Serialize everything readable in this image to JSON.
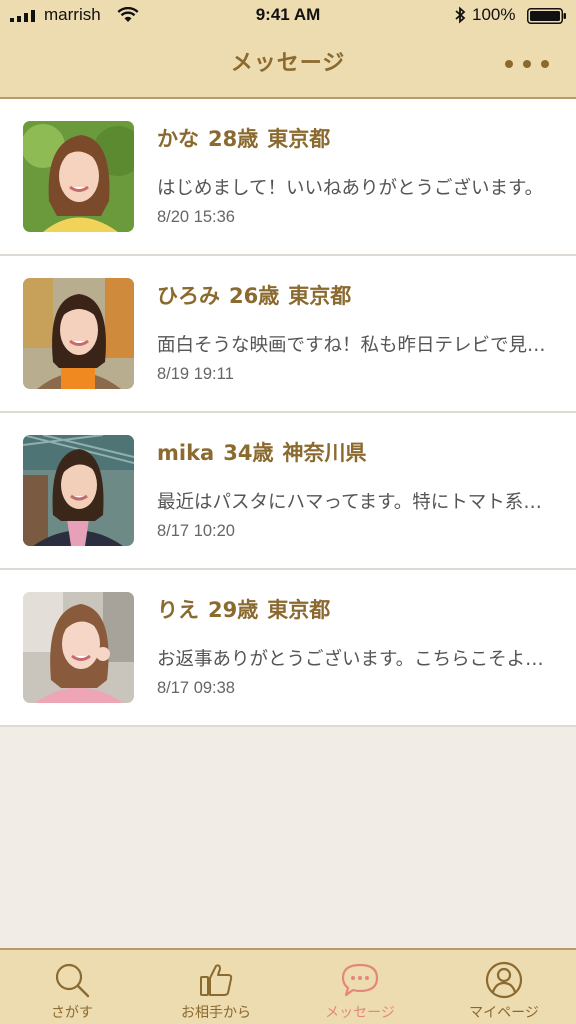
{
  "status_bar": {
    "carrier": "marrish",
    "time": "9:41 AM",
    "battery": "100%"
  },
  "header": {
    "title": "メッセージ",
    "more_icon": "more-dots-icon"
  },
  "messages": [
    {
      "name": "かな",
      "age": "28歳",
      "location": "東京都",
      "preview": "はじめまして！いいねありがとうございます。",
      "time": "8/20 15:36"
    },
    {
      "name": "ひろみ",
      "age": "26歳",
      "location": "東京都",
      "preview": "面白そうな映画ですね！私も昨日テレビで見ました。",
      "time": "8/19 19:11"
    },
    {
      "name": "mika",
      "age": "34歳",
      "location": "神奈川県",
      "preview": "最近はパスタにハマってます。特にトマト系が好きです。",
      "time": "8/17 10:20"
    },
    {
      "name": "りえ",
      "age": "29歳",
      "location": "東京都",
      "preview": "お返事ありがとうございます。こちらこそよろしくお願いします。",
      "time": "8/17 09:38"
    }
  ],
  "tabs": [
    {
      "label": "さがす",
      "icon": "search-icon",
      "active": false
    },
    {
      "label": "お相手から",
      "icon": "thumbs-up-icon",
      "active": false
    },
    {
      "label": "メッセージ",
      "icon": "chat-bubble-icon",
      "active": true
    },
    {
      "label": "マイページ",
      "icon": "profile-icon",
      "active": false
    }
  ],
  "colors": {
    "header_bg": "#eedcb1",
    "accent_brown": "#8b6a30",
    "active_tab": "#e5867c",
    "page_bg": "#f1ece5"
  }
}
